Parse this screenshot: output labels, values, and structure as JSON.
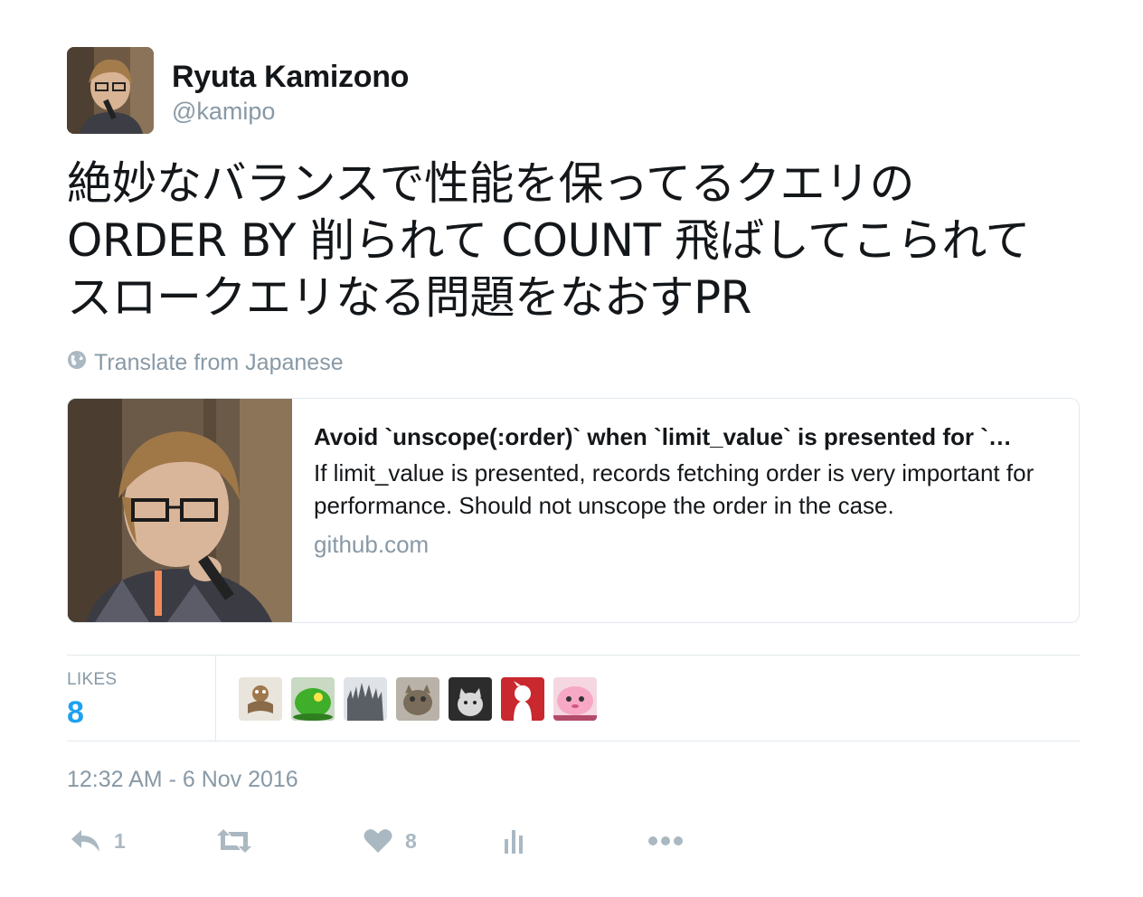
{
  "author": {
    "name": "Ryuta Kamizono",
    "handle": "@kamipo"
  },
  "tweet": {
    "text_lines": [
      "絶妙なバランスで性能を保ってるクエリの",
      "ORDER BY 削られて COUNT 飛ばしてこられて",
      "スロークエリなる問題をなおすPR"
    ],
    "translate_label": "Translate from Japanese"
  },
  "card": {
    "title": "Avoid `unscope(:order)` when `limit_value` is presented for `…",
    "description": "If limit_value is presented, records fetching order is very important for performance. Should not unscope the order in the case.",
    "domain": "github.com"
  },
  "stats": {
    "likes_label": "LIKES",
    "likes_count": "8"
  },
  "timestamp": "12:32 AM - 6 Nov 2016",
  "actions": {
    "reply_count": "1",
    "like_count": "8"
  },
  "colors": {
    "accent": "#1da1f2",
    "muted": "#8899a6",
    "icon": "#aab8c2",
    "border": "#e1e8ed"
  },
  "icons": [
    "globe-icon",
    "reply-icon",
    "retweet-icon",
    "heart-icon",
    "analytics-icon",
    "more-icon"
  ]
}
